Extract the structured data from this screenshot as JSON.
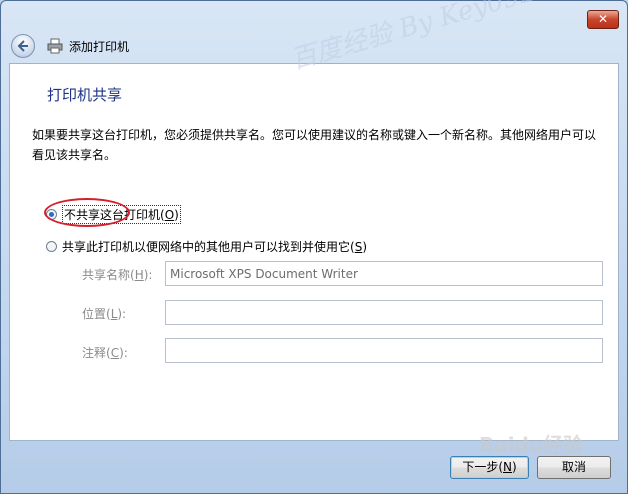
{
  "window": {
    "title": "添加打印机",
    "close_label": "✕"
  },
  "page": {
    "heading": "打印机共享",
    "description": "如果要共享这台打印机，您必须提供共享名。您可以使用建议的名称或键入一个新名称。其他网络用户可以看见该共享名。"
  },
  "options": {
    "no_share": {
      "text": "不共享这台打印机(",
      "key": "O",
      "close": ")",
      "selected": true
    },
    "share": {
      "text": "共享此打印机以便网络中的其他用户可以找到并使用它(",
      "key": "S",
      "close": ")",
      "selected": false
    }
  },
  "fields": {
    "share_name": {
      "label": "共享名称(",
      "key": "H",
      "close": "):",
      "value": "Microsoft XPS Document Writer"
    },
    "location": {
      "label": "位置(",
      "key": "L",
      "close": "):",
      "value": ""
    },
    "comment": {
      "label": "注释(",
      "key": "C",
      "close": "):",
      "value": ""
    }
  },
  "buttons": {
    "next": {
      "text": "下一步(",
      "key": "N",
      "close": ")"
    },
    "cancel": "取消"
  },
  "watermarks": {
    "center": "百度经验 By Key0928",
    "corner": "Baidu经验"
  },
  "colors": {
    "heading": "#1e3287",
    "highlight": "#d4202a"
  }
}
